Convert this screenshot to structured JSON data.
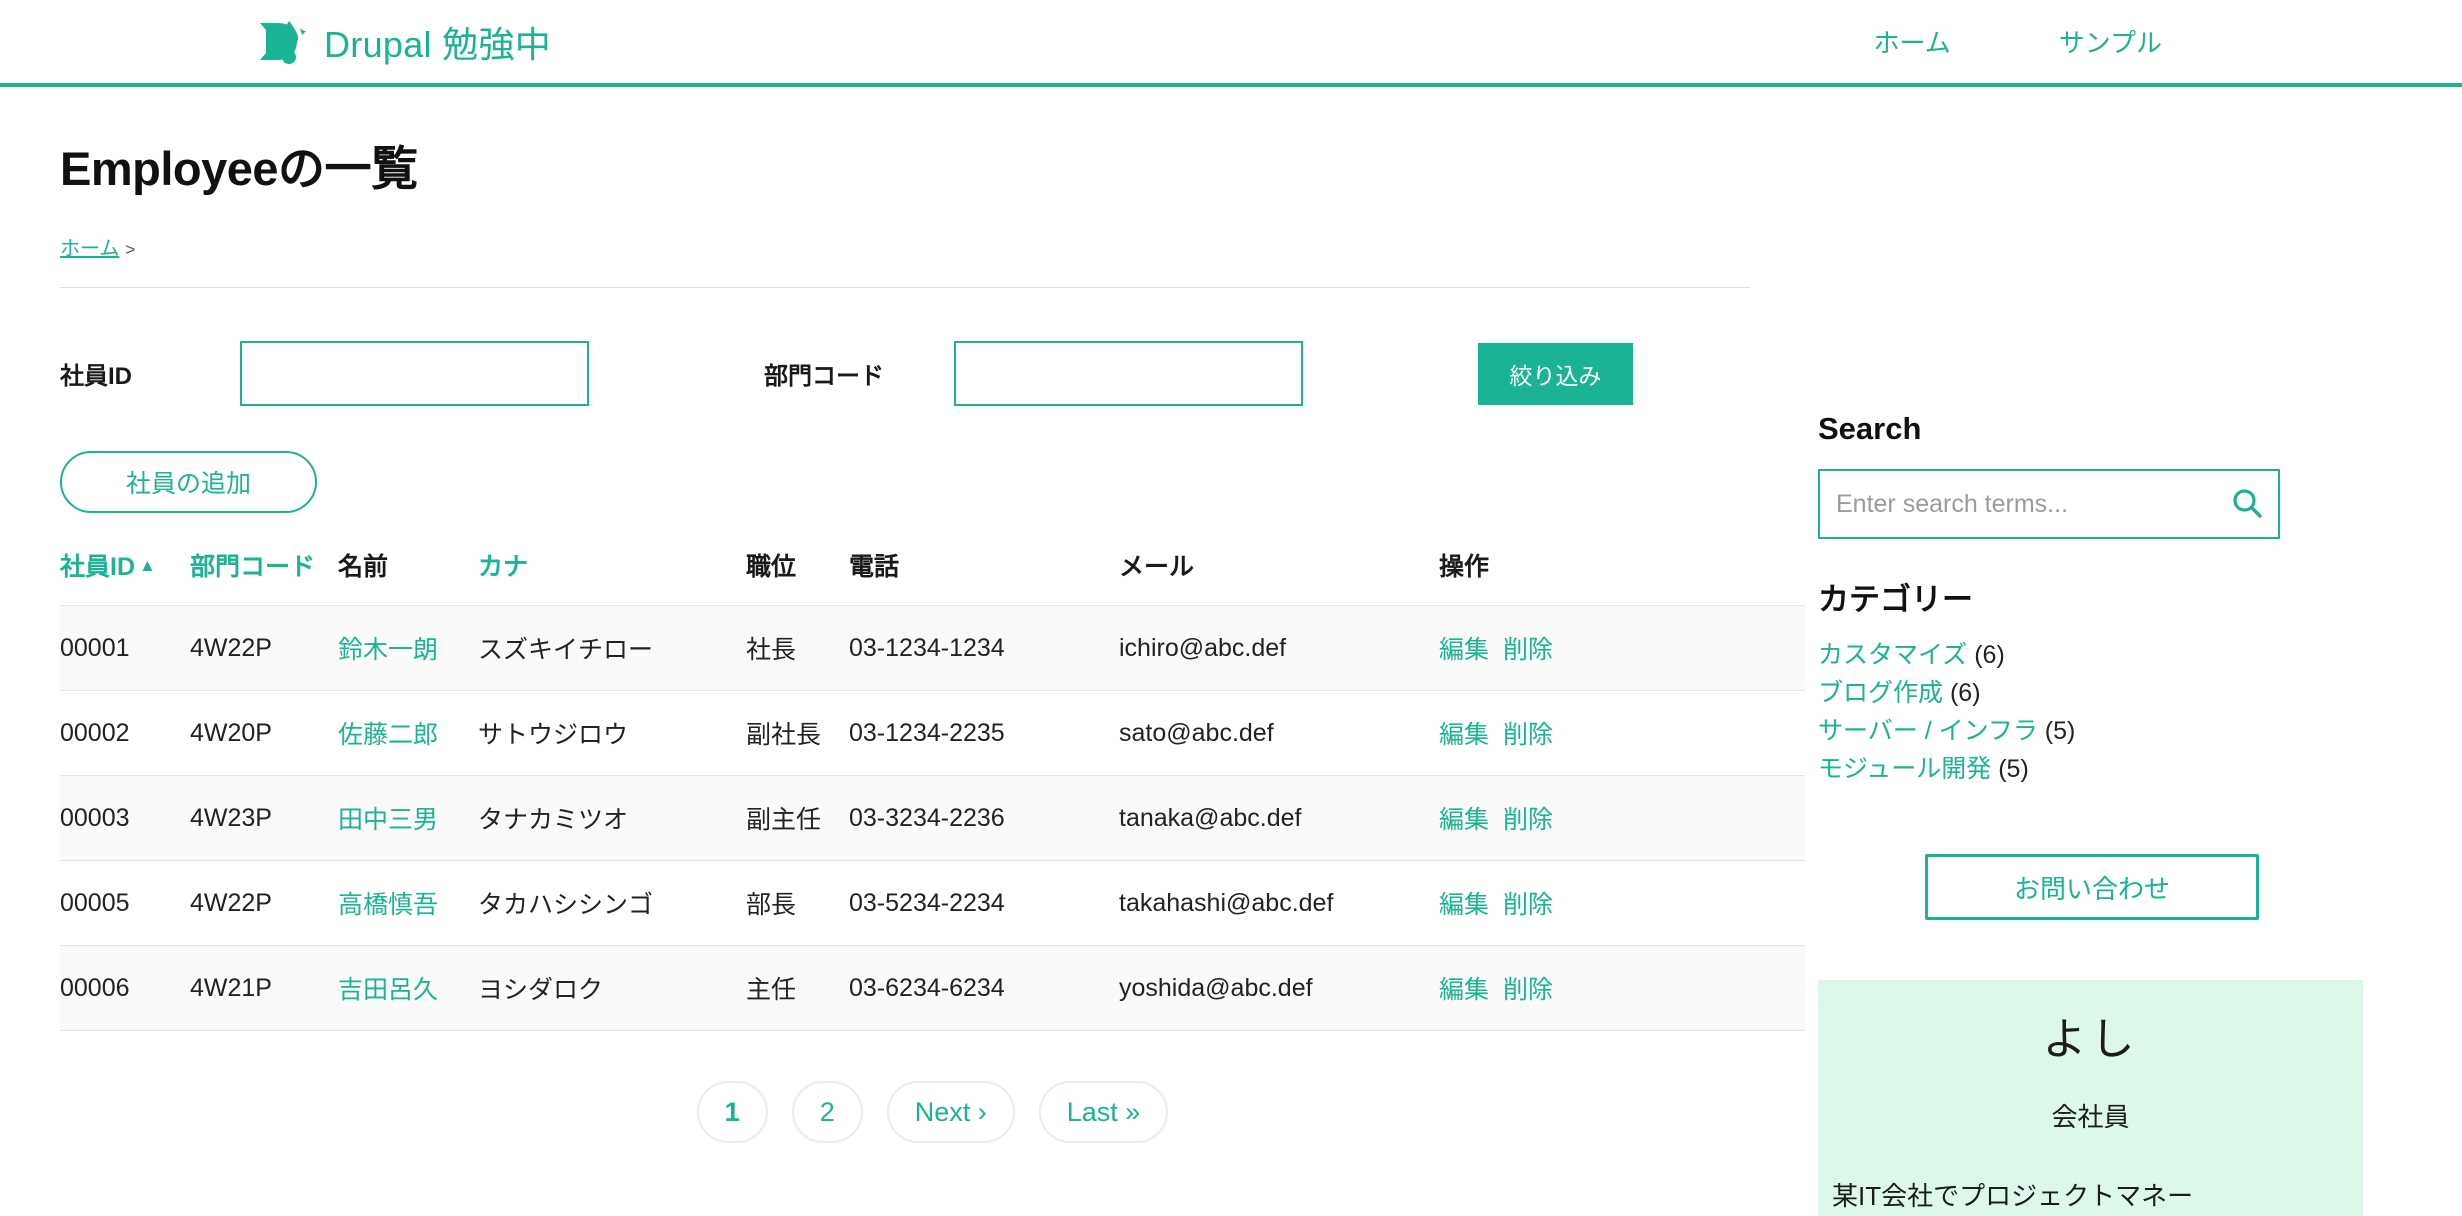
{
  "header": {
    "brand_name": "Drupal 勉強中",
    "logo_icon": "drupal-drop-d-logo",
    "nav": [
      {
        "label": "ホーム"
      },
      {
        "label": "サンプル"
      }
    ]
  },
  "main": {
    "page_title": "Employeeの一覧",
    "breadcrumb": {
      "home_label": "ホーム",
      "separator": ">"
    },
    "filter": {
      "employee_id_label": "社員ID",
      "employee_id_value": "",
      "department_label": "部門コード",
      "department_value": "",
      "submit_label": "絞り込み"
    },
    "add_button_label": "社員の追加",
    "table": {
      "columns": [
        {
          "label": "社員ID",
          "sortable": true,
          "sort_indicator": "▲"
        },
        {
          "label": "部門コード",
          "sortable": true
        },
        {
          "label": "名前",
          "sortable": false
        },
        {
          "label": "カナ",
          "sortable": true
        },
        {
          "label": "職位",
          "sortable": false
        },
        {
          "label": "電話",
          "sortable": false
        },
        {
          "label": "メール",
          "sortable": false
        },
        {
          "label": "操作",
          "sortable": false
        }
      ],
      "rows": [
        {
          "id": "00001",
          "dept": "4W22P",
          "name": "鈴木一朗",
          "kana": "スズキイチロー",
          "position": "社長",
          "tel": "03-1234-1234",
          "mail": "ichiro@abc.def",
          "edit": "編集",
          "delete": "削除"
        },
        {
          "id": "00002",
          "dept": "4W20P",
          "name": "佐藤二郎",
          "kana": "サトウジロウ",
          "position": "副社長",
          "tel": "03-1234-2235",
          "mail": "sato@abc.def",
          "edit": "編集",
          "delete": "削除"
        },
        {
          "id": "00003",
          "dept": "4W23P",
          "name": "田中三男",
          "kana": "タナカミツオ",
          "position": "副主任",
          "tel": "03-3234-2236",
          "mail": "tanaka@abc.def",
          "edit": "編集",
          "delete": "削除"
        },
        {
          "id": "00005",
          "dept": "4W22P",
          "name": "高橋慎吾",
          "kana": "タカハシシンゴ",
          "position": "部長",
          "tel": "03-5234-2234",
          "mail": "takahashi@abc.def",
          "edit": "編集",
          "delete": "削除"
        },
        {
          "id": "00006",
          "dept": "4W21P",
          "name": "吉田呂久",
          "kana": "ヨシダロク",
          "position": "主任",
          "tel": "03-6234-6234",
          "mail": "yoshida@abc.def",
          "edit": "編集",
          "delete": "削除"
        }
      ]
    },
    "pager": {
      "pages": [
        {
          "label": "1",
          "current": true
        },
        {
          "label": "2",
          "current": false
        }
      ],
      "next_label": "Next ›",
      "last_label": "Last »"
    }
  },
  "sidebar": {
    "search": {
      "title": "Search",
      "placeholder": "Enter search terms...",
      "value": "",
      "icon": "search-icon"
    },
    "categories": {
      "title": "カテゴリー",
      "items": [
        {
          "label": "カスタマイズ",
          "count": "(6)"
        },
        {
          "label": "ブログ作成",
          "count": "(6)"
        },
        {
          "label": "サーバー / インフラ",
          "count": "(5)"
        },
        {
          "label": "モジュール開発",
          "count": "(5)"
        }
      ]
    },
    "contact_button_label": "お問い合わせ",
    "profile": {
      "name": "よし",
      "role": "会社員",
      "bio": "某IT会社でプロジェクトマネー"
    }
  },
  "colors": {
    "accent": "#1ab394",
    "profile_card_bg": "#ddf8e8",
    "row_stripe": "#fafafa",
    "text": "#222222"
  }
}
